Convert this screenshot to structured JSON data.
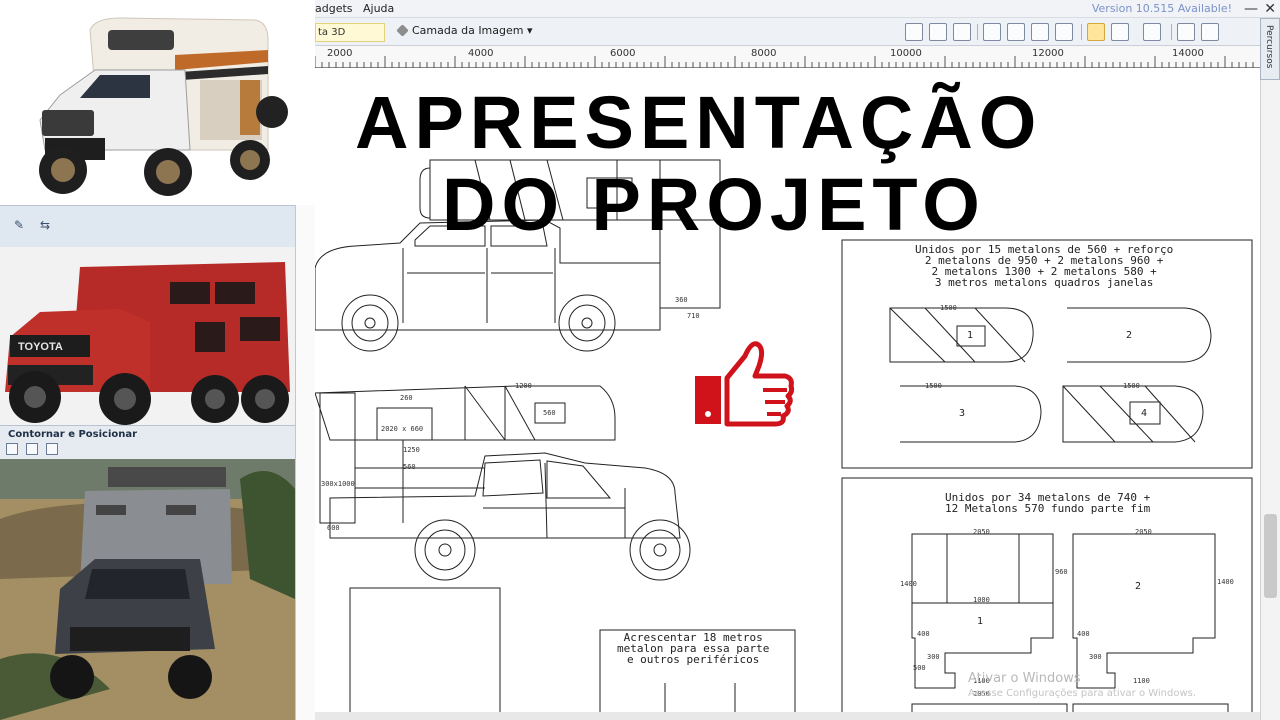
{
  "menu": {
    "items": [
      "adgets",
      "Ajuda"
    ],
    "version": "Version 10.515 Available!"
  },
  "window_controls": {
    "minimize": "—",
    "close": "✕"
  },
  "toolbar": {
    "tab_3d": "ta 3D",
    "layer_button": "Camada da Imagem ▾"
  },
  "side_tab": "Percursos",
  "ruler": {
    "ticks": [
      "2000",
      "4000",
      "6000",
      "8000",
      "10000",
      "12000",
      "14000"
    ]
  },
  "left_panel": {
    "section_label": "Contornar e Posicionar"
  },
  "title": {
    "line1": "APRESENTAÇÃO",
    "line2": "DO PROJETO"
  },
  "notes": {
    "box1": [
      "Unidos por 15 metalons de 560 + reforço",
      "2 metalons de 950 + 2 metalons 960 +",
      "2 metalons 1300 + 2 metalons 580 +",
      "3 metros metalons quadros janelas"
    ],
    "box2": [
      "Unidos por 34 metalons de 740 +",
      "12 Metalons 570 fundo parte fim"
    ],
    "box3": [
      "Acrescentar 18 metros",
      "metalon para essa parte",
      "e outros periféricos"
    ]
  },
  "dimensions": {
    "truck1": [
      "360",
      "710"
    ],
    "truck2": [
      "1200",
      "260",
      "1250",
      "560",
      "300x1000",
      "2020 x 660",
      "600",
      "560"
    ],
    "panels1": [
      "1500",
      "1",
      "2",
      "3",
      "4",
      "1500",
      "1500"
    ],
    "panels2": [
      "2050",
      "1000",
      "1400",
      "960",
      "400",
      "300",
      "500",
      "1100",
      "1",
      "2",
      "2050",
      "1400",
      "400",
      "300",
      "1100",
      "2050"
    ]
  },
  "watermark": {
    "line1": "Ativar o Windows",
    "line2": "Acesse Configurações para ativar o Windows."
  },
  "colors": {
    "like": "#d0121b",
    "title": "#000000",
    "ui_bg": "#eef1f6"
  }
}
